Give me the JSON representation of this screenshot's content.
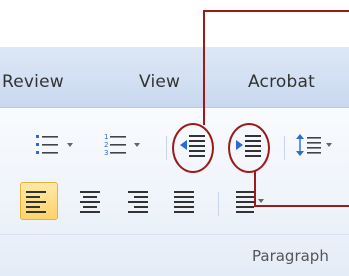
{
  "tabs": {
    "review": "Review",
    "view": "View",
    "acrobat": "Acrobat"
  },
  "group": {
    "label": "Paragraph"
  },
  "icons": {
    "bullets": "bulleted-list-icon",
    "numbering": "numbered-list-icon",
    "decrease_indent": "decrease-indent-icon",
    "increase_indent": "increase-indent-icon",
    "line_spacing": "line-spacing-icon",
    "align_left": "align-left-icon",
    "center": "align-center-icon",
    "align_right": "align-right-icon",
    "justify": "justify-icon",
    "columns": "columns-icon"
  },
  "colors": {
    "callout": "#9b1b1b",
    "selected": "#fdd36a",
    "icon_blue": "#2a6ad2"
  }
}
